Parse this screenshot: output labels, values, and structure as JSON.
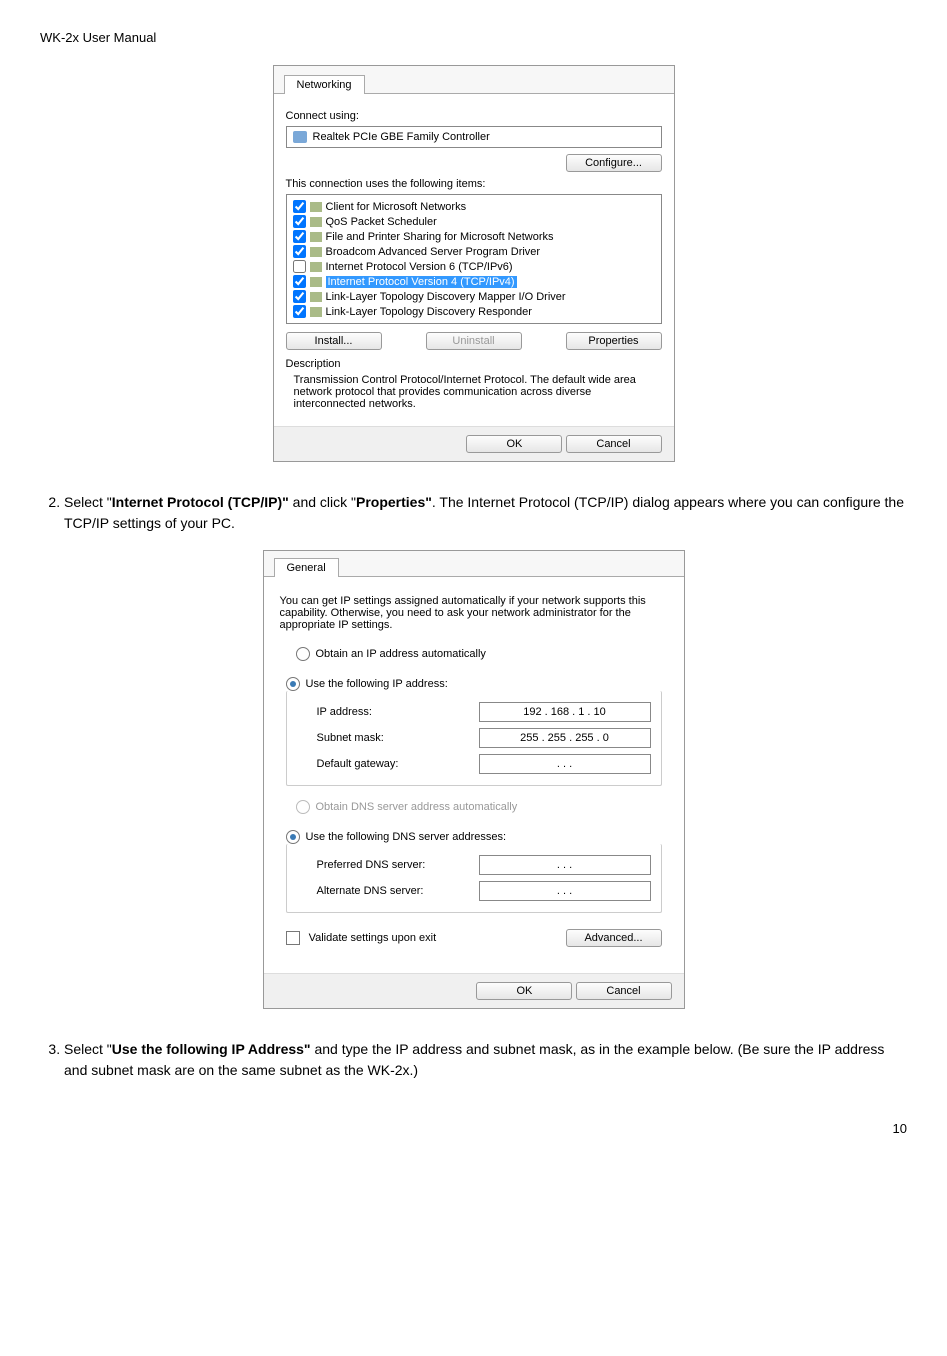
{
  "header": "WK-2x User Manual",
  "page_number": "10",
  "steps": {
    "s2": {
      "num": "2.",
      "pre": "Select \"",
      "bold1": "Internet Protocol (TCP/IP)\"",
      "mid1": " and click \"",
      "bold2": "Properties\"",
      "post": ".  The Internet Protocol (TCP/IP) dialog appears where you can configure the TCP/IP settings of your PC."
    },
    "s3": {
      "num": "3.",
      "pre": "Select \"",
      "bold1": "Use the following IP Address\"",
      "post": " and type the IP address and subnet mask, as in the example below.  (Be sure the IP address and subnet mask are on the same subnet as the WK-2x.)"
    }
  },
  "dialog1": {
    "tab": "Networking",
    "connect_using": "Connect using:",
    "adapter": "Realtek PCIe GBE Family Controller",
    "configure_btn": "Configure...",
    "items_label": "This connection uses the following items:",
    "items": [
      {
        "checked": true,
        "label": "Client for Microsoft Networks"
      },
      {
        "checked": true,
        "label": "QoS Packet Scheduler"
      },
      {
        "checked": true,
        "label": "File and Printer Sharing for Microsoft Networks"
      },
      {
        "checked": true,
        "label": "Broadcom Advanced Server Program Driver"
      },
      {
        "checked": false,
        "label": "Internet Protocol Version 6 (TCP/IPv6)"
      },
      {
        "checked": true,
        "label": "Internet Protocol Version 4 (TCP/IPv4)",
        "highlight": true
      },
      {
        "checked": true,
        "label": "Link-Layer Topology Discovery Mapper I/O Driver"
      },
      {
        "checked": true,
        "label": "Link-Layer Topology Discovery Responder"
      }
    ],
    "install_btn": "Install...",
    "uninstall_btn": "Uninstall",
    "properties_btn": "Properties",
    "desc_title": "Description",
    "desc_text": "Transmission Control Protocol/Internet Protocol. The default wide area network protocol that provides communication across diverse interconnected networks.",
    "ok": "OK",
    "cancel": "Cancel"
  },
  "dialog2": {
    "tab": "General",
    "intro": "You can get IP settings assigned automatically if your network supports this capability. Otherwise, you need to ask your network administrator for the appropriate IP settings.",
    "radio_auto_ip": "Obtain an IP address automatically",
    "radio_use_ip": "Use the following IP address:",
    "ip_label": "IP address:",
    "ip_value": "192 . 168 .   1   .  10",
    "subnet_label": "Subnet mask:",
    "subnet_value": "255 . 255 . 255 .   0",
    "gateway_label": "Default gateway:",
    "gateway_value": ".        .        .",
    "radio_auto_dns": "Obtain DNS server address automatically",
    "radio_use_dns": "Use the following DNS server addresses:",
    "pref_dns_label": "Preferred DNS server:",
    "pref_dns_value": ".        .        .",
    "alt_dns_label": "Alternate DNS server:",
    "alt_dns_value": ".        .        .",
    "validate": "Validate settings upon exit",
    "advanced_btn": "Advanced...",
    "ok": "OK",
    "cancel": "Cancel"
  }
}
